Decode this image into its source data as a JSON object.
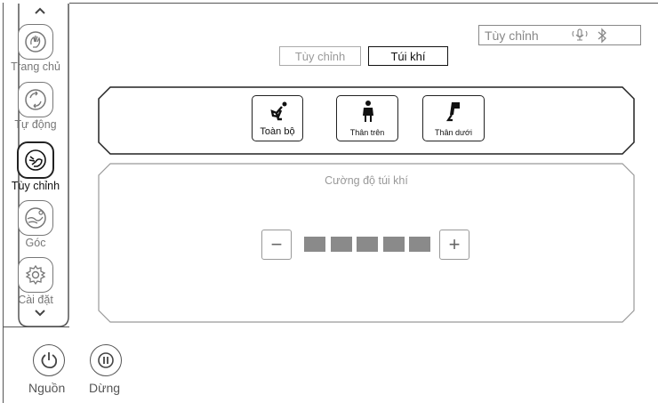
{
  "sidebar": {
    "up_icon": "chevron-up-icon",
    "down_icon": "chevron-down-icon",
    "items": [
      {
        "label": "Trang chủ",
        "icon": "home-hand-icon",
        "active": false
      },
      {
        "label": "Tự động",
        "icon": "auto-cycle-icon",
        "active": false
      },
      {
        "label": "Tùy chỉnh",
        "icon": "custom-hand-icon",
        "active": true
      },
      {
        "label": "Góc",
        "icon": "recline-angle-icon",
        "active": false
      },
      {
        "label": "Cài đặt",
        "icon": "settings-gear-icon",
        "active": false
      }
    ]
  },
  "status": {
    "mode_text": "Tùy chỉnh",
    "icons": [
      "microphone-icon",
      "bluetooth-icon"
    ]
  },
  "tabs": [
    {
      "label": "Tùy chỉnh",
      "active": false
    },
    {
      "label": "Túi khí",
      "active": true
    }
  ],
  "modes": [
    {
      "label": "Toàn bộ",
      "icon": "full-body-icon"
    },
    {
      "label": "Thân trên",
      "icon": "upper-body-icon"
    },
    {
      "label": "Thân dưới",
      "icon": "lower-body-icon"
    }
  ],
  "intensity": {
    "title": "Cường độ túi khí",
    "minus_label": "−",
    "plus_label": "+",
    "levels_total": 5,
    "levels_filled": 5
  },
  "footer": {
    "power_label": "Nguồn",
    "pause_label": "Dừng"
  },
  "colors": {
    "level_fill": "#8a8a8a",
    "frame": "#555555"
  }
}
